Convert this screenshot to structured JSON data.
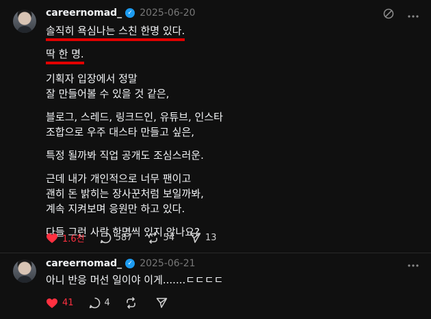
{
  "posts": [
    {
      "username": "careernomad_",
      "date": "2025-06-20",
      "highlight_1": "솔직히 욕심나는 스친 한명 있다.",
      "highlight_2": "딱 한 명.",
      "paragraphs": [
        [
          "기획자 입장에서 정말",
          "잘 만들어볼 수 있을 것 같은,"
        ],
        [
          "블로그, 스레드, 링크드인, 유튜브, 인스타",
          "조합으로 우주 대스타 만들고 싶은,"
        ],
        [
          "특정 될까봐 직업 공개도 조심스러운."
        ],
        [
          "근데 내가 개인적으로 너무 팬이고",
          "괜히 돈 밝히는 장사꾼처럼 보일까봐,",
          "계속 지켜보며 응원만 하고 있다."
        ],
        [
          "다들 그런 사람 한명씩 있지 않나요?"
        ]
      ],
      "likes": "1.6천",
      "replies": "587",
      "reposts": "54",
      "shares": "13",
      "icons": {
        "like": "heart-filled-icon",
        "reply": "comment-bubble-icon",
        "repost": "repost-arrows-icon",
        "share": "share-arrow-icon",
        "translate": "translate-icon",
        "more": "more-dots-icon"
      },
      "like_color": "#ff3040"
    },
    {
      "username": "careernomad_",
      "date": "2025-06-21",
      "text": "아니 반응 머선 일이야 이게.......ㄷㄷㄷㄷ",
      "likes": "41",
      "replies": "4",
      "icons": {
        "like": "heart-filled-icon",
        "reply": "comment-bubble-icon",
        "repost": "repost-arrows-icon",
        "share": "share-arrow-icon",
        "more": "more-dots-icon"
      },
      "like_color": "#ff3040"
    }
  ],
  "colors": {
    "background": "#101010",
    "text": "#f3f5f7",
    "muted": "#777777",
    "verified": "#1d9bf0",
    "highlight_underline": "#e10000"
  }
}
